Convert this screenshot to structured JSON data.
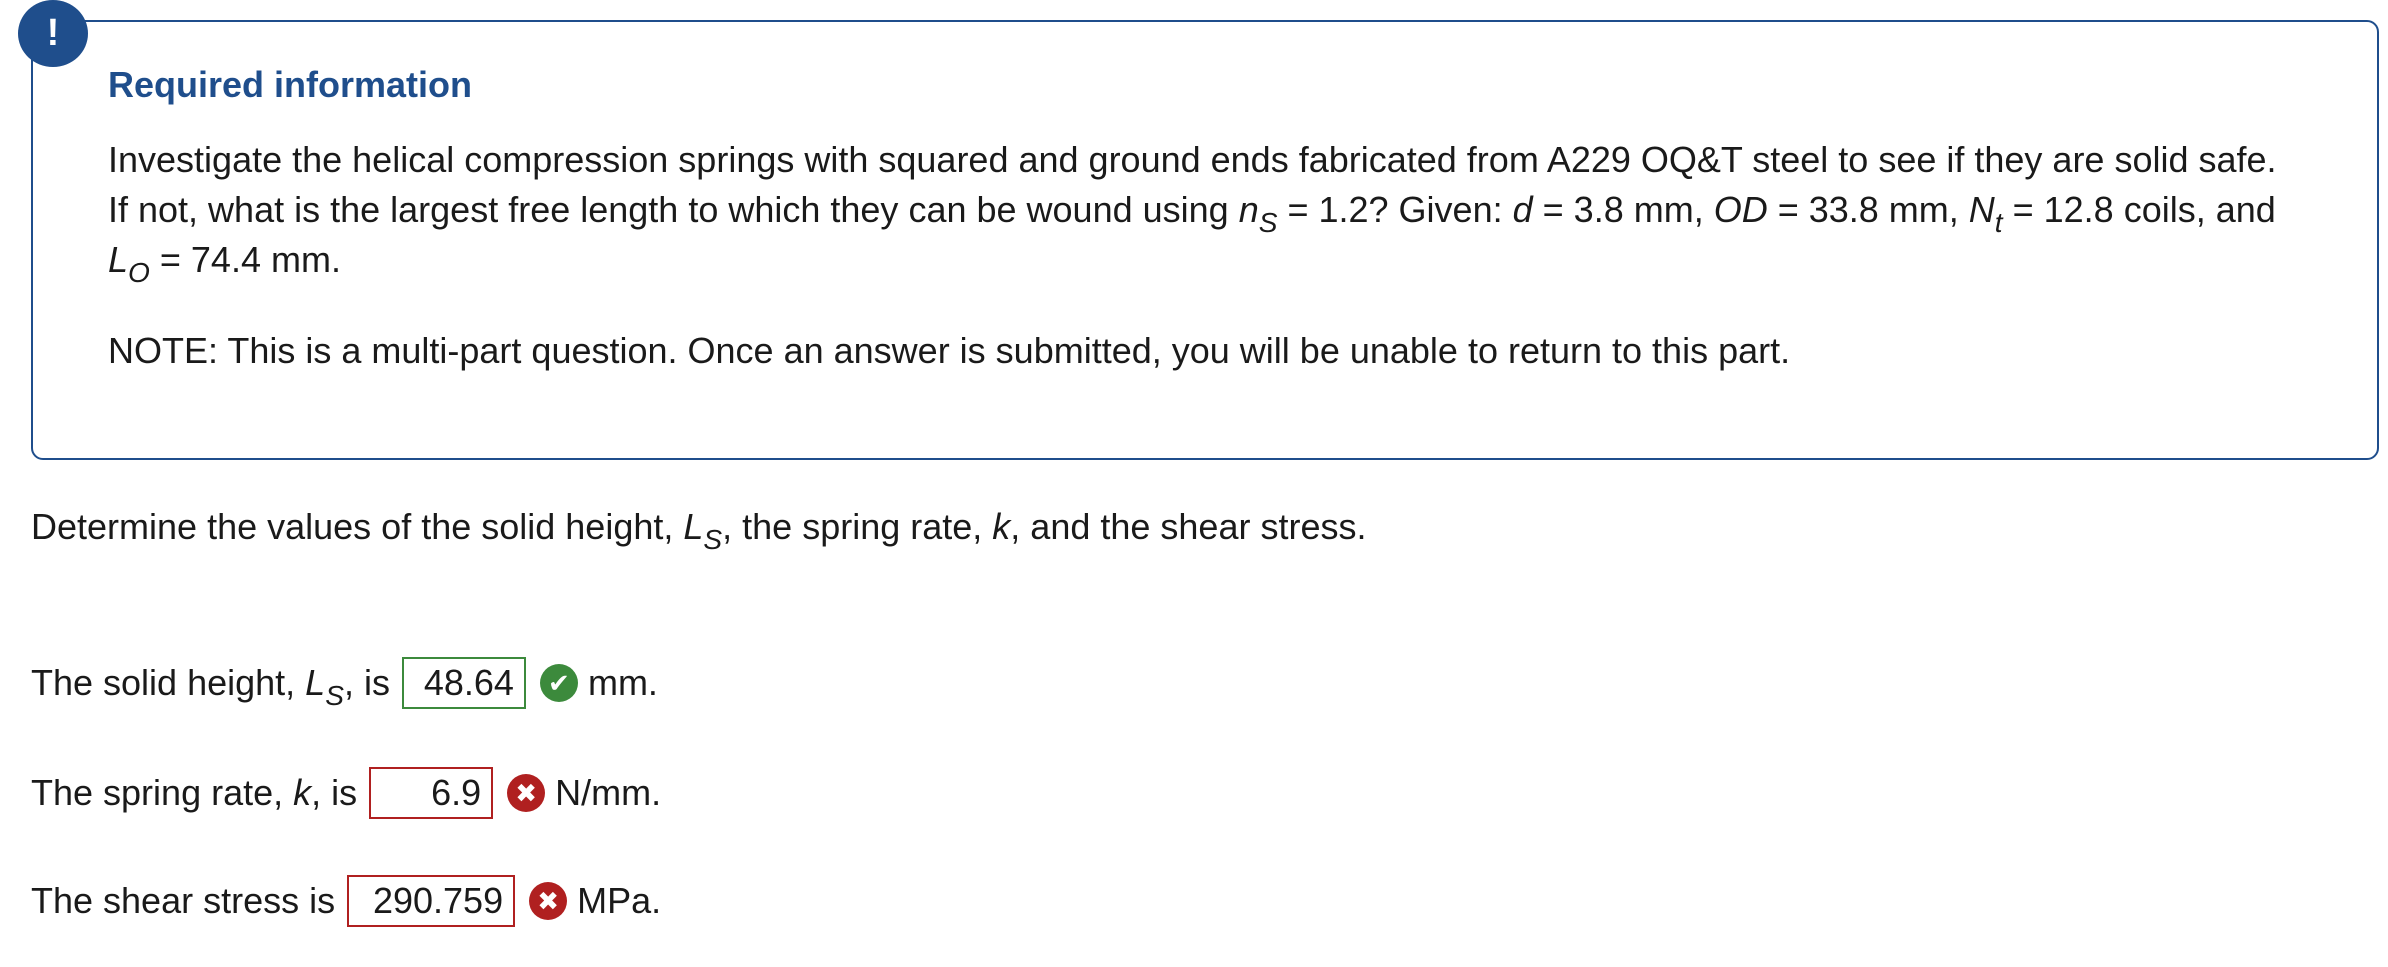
{
  "alert": {
    "badge": "!",
    "title": "Required information",
    "text_1": "Investigate the helical compression springs with squared and ground ends fabricated from A229 OQ&T steel to see if they are solid safe. If not, what is the largest free length to which they can be wound using ",
    "ns_var": "n",
    "ns_sub": "S",
    "text_2": " = 1.2? Given: ",
    "d_var": "d",
    "text_3": " = 3.8 mm, ",
    "od_var": "OD",
    "text_4": " = 33.8 mm, ",
    "nt_var": "N",
    "nt_sub": "t",
    "text_5": " = 12.8 coils, and  ",
    "lo_var": "L",
    "lo_sub": "O",
    "text_6": " = 74.4 mm.",
    "note": "NOTE: This is a multi-part question. Once an answer is submitted, you will be unable to return to this part."
  },
  "prompt": {
    "text_1": "Determine the values of the solid height, ",
    "ls_var": "L",
    "ls_sub": "S",
    "text_2": ", the spring rate, ",
    "k_var": "k",
    "text_3": ", and the shear stress."
  },
  "answers": [
    {
      "label_1": "The solid height, ",
      "var": "L",
      "sub": "S",
      "label_2": ", is",
      "value": "48.64",
      "status": "correct",
      "status_icon": "check-icon",
      "unit": "mm."
    },
    {
      "label_1": "The spring rate, ",
      "var": "k",
      "sub": "",
      "label_2": ", is",
      "value": "6.9",
      "status": "incorrect",
      "status_icon": "x-icon",
      "unit": "N/mm."
    },
    {
      "label_1": "The shear stress is",
      "var": "",
      "sub": "",
      "label_2": "",
      "value": "290.759",
      "status": "incorrect",
      "status_icon": "x-icon",
      "unit": "MPa."
    }
  ],
  "colors": {
    "accent": "#1f4e8c",
    "correct": "#3c8a3c",
    "incorrect": "#b02020"
  }
}
